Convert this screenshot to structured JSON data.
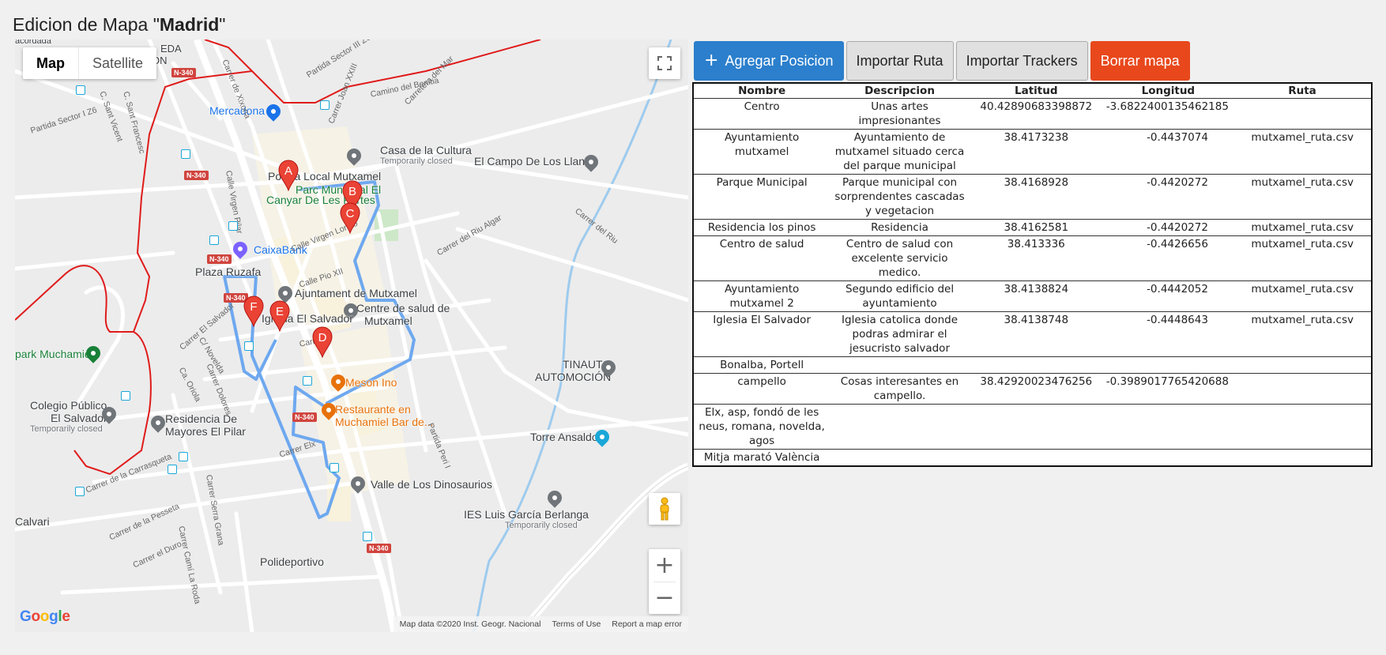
{
  "header": {
    "title_prefix": "Edicion de Mapa \"",
    "title_name": "Madrid",
    "title_suffix": "\""
  },
  "map": {
    "type_map": "Map",
    "type_satellite": "Satellite",
    "zoom_in": "+",
    "zoom_out": "−",
    "attribution_data": "Map data ©2020 Inst. Geogr. Nacional",
    "attribution_terms": "Terms of Use",
    "attribution_report": "Report a map error",
    "google_letters": [
      "G",
      "o",
      "o",
      "g",
      "l",
      "e"
    ],
    "markers": [
      "A",
      "B",
      "C",
      "D",
      "E",
      "F"
    ],
    "route_color": "#6ea8ef",
    "boundary_color": "#e01b1b",
    "places": {
      "mercadona": "Mercadona",
      "casa_cultura": "Casa de la Cultura",
      "casa_cultura_sub": "Temporarily closed",
      "campo_llanos": "El Campo De Los Llanos",
      "policia_local": "Policia Local Mutxamel",
      "parc_municipal_1": "Parc Municipal El",
      "parc_municipal_2": "Canyar De Les Portes",
      "caixabank": "CaixaBank",
      "plaza_ruzafa": "Plaza Ruzafa",
      "ajuntament": "Ajuntament de Mutxamel",
      "centre_salut_1": "Centre de salud de",
      "centre_salut_2": "Mutxamel",
      "iglesia": "Iglesia El Salvador",
      "park": "park Muchamiel",
      "meson": "Meson Ino",
      "restaurante_1": "Restaurante en",
      "restaurante_2": "Muchamiel Bar de...",
      "tinauto_1": "TINAUTO",
      "tinauto_2": "AUTOMOCIÓN",
      "colegio_1": "Colegio Público",
      "colegio_2": "El Salvador",
      "colegio_sub": "Temporarily closed",
      "residencia_1": "Residencia De",
      "residencia_2": "Mayores El Pilar",
      "torre": "Torre Ansaldo",
      "valle": "Valle de Los Dinosaurios",
      "ies": "IES Luis García Berlanga",
      "ies_sub": "Temporarily closed",
      "polideportivo": "Polideportivo",
      "calvari": "Calvari",
      "acordada": "acordada",
      "eda_1": "EDA",
      "eda_2": "CIÓN"
    },
    "roads": {
      "n340": "N-340",
      "c_xixona": "Carrer de Xixona",
      "partida_sector_iii": "Partida Sector III Z6",
      "partida_sector_i": "Partida Sector I Z6",
      "camino_benitia": "Camino del Benitia",
      "carretera_mar": "Carretera del Mar",
      "carrer_joan": "Carrer Joan XXIII",
      "calle_virgen_pilar": "Calle Virgen Pilar",
      "calle_virgen_loreto": "Calle Virgen Loreto",
      "calle_pio": "Calle Pio XII",
      "carrer_riu_algar": "Carrer del Riu Algar",
      "carrer_riu": "Carrer del Riu",
      "carrer_salvador": "Carrer El Salvador",
      "c_novelda": "C/ Novelda",
      "c_oriola": "Ca. Oriola",
      "carrer_dolores": "Carrer Dolores",
      "carrer_elx": "Carrer Elx",
      "carrer_carrasqueta": "Carrer de la Carrasqueta",
      "carrer_serra": "Carrer Serra Grana",
      "carrer_pesseta": "Carrer de la Pesseta",
      "carrer_dur": "Carrer el Duro",
      "carrer_cami": "Carrer Camí La Roda",
      "c_sant_vicent": "C. Sant Vicent",
      "c_sant_francesc": "C. Sant Francesc",
      "partida_peri": "Partida Peri I",
      "carrer": "Carrer"
    }
  },
  "toolbar": {
    "add_icon": "+",
    "add_label": "Agregar Posicion",
    "import_route": "Importar Ruta",
    "import_trackers": "Importar Trackers",
    "delete_map": "Borrar mapa"
  },
  "table": {
    "headers": [
      "Nombre",
      "Descripcion",
      "Latitud",
      "Longitud",
      "Ruta"
    ],
    "rows": [
      [
        "Centro",
        "Unas artes impresionantes",
        "40.42890683398872",
        "-3.6822400135462185",
        ""
      ],
      [
        "Ayuntamiento mutxamel",
        "Ayuntamiento de mutxamel situado cerca del parque municipal",
        "38.4173238",
        "-0.4437074",
        "mutxamel_ruta.csv"
      ],
      [
        "Parque Municipal",
        "Parque municipal con sorprendentes cascadas y vegetacion",
        "38.4168928",
        "-0.4420272",
        "mutxamel_ruta.csv"
      ],
      [
        "Residencia los pinos",
        "Residencia",
        "38.4162581",
        "-0.4420272",
        "mutxamel_ruta.csv"
      ],
      [
        "Centro de salud",
        "Centro de salud con excelente servicio medico.",
        "38.413336",
        "-0.4426656",
        "mutxamel_ruta.csv"
      ],
      [
        "Ayuntamiento mutxamel 2",
        "Segundo edificio del ayuntamiento",
        "38.4138824",
        "-0.4442052",
        "mutxamel_ruta.csv"
      ],
      [
        "Iglesia El Salvador",
        "Iglesia catolica donde podras admirar el jesucristo salvador",
        "38.4138748",
        "-0.4448643",
        "mutxamel_ruta.csv"
      ],
      [
        "Bonalba, Portell",
        "",
        "",
        "",
        ""
      ],
      [
        "campello",
        "Cosas interesantes en campello.",
        "38.42920023476256",
        "-0.3989017765420688",
        ""
      ],
      [
        "Elx, asp, fondó de les neus, romana, novelda, agos",
        "",
        "",
        "",
        ""
      ],
      [
        "Mitja marató València",
        "",
        "",
        "",
        ""
      ]
    ]
  }
}
